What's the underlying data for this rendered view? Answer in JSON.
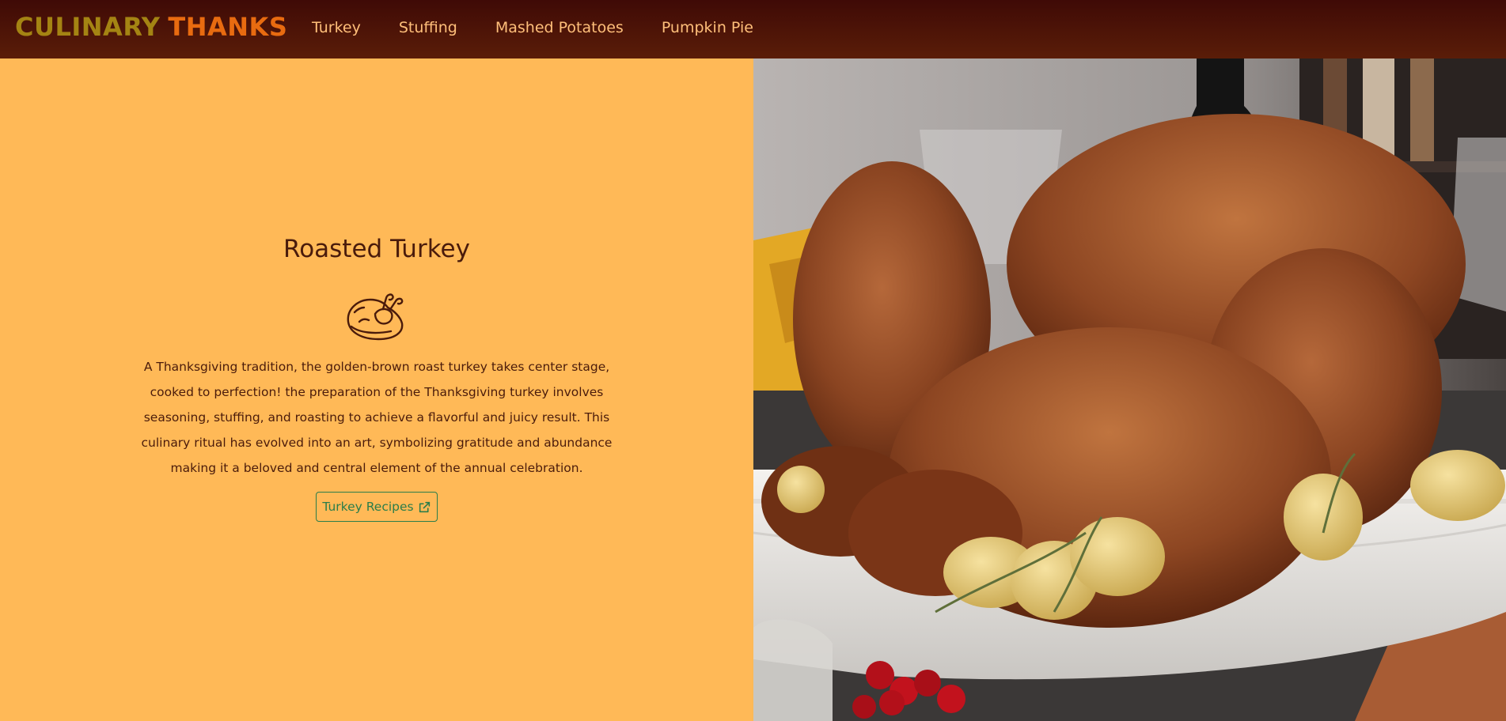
{
  "brand": {
    "word1": "CULINARY",
    "word2": "THANKS"
  },
  "nav": {
    "items": [
      {
        "label": "Turkey"
      },
      {
        "label": "Stuffing"
      },
      {
        "label": "Mashed Potatoes"
      },
      {
        "label": "Pumpkin Pie"
      }
    ]
  },
  "hero": {
    "title": "Roasted Turkey",
    "icon": "roast-turkey-icon",
    "description": "A Thanksgiving tradition, the golden-brown roast turkey takes center stage, cooked to perfection! the preparation of the Thanksgiving turkey involves seasoning, stuffing, and roasting to achieve a flavorful and juicy result. This culinary ritual has evolved into an art, symbolizing gratitude and abundance making it a beloved and central element of the annual celebration.",
    "button_label": "Turkey Recipes",
    "button_icon": "external-link-icon"
  },
  "colors": {
    "nav_background": "#4a1206",
    "brand_word1": "#a48413",
    "brand_word2": "#e86b10",
    "nav_link": "#ffbf7a",
    "panel_background": "#ffb957",
    "text": "#4a1b0b",
    "button_accent": "#2a7d4a"
  }
}
